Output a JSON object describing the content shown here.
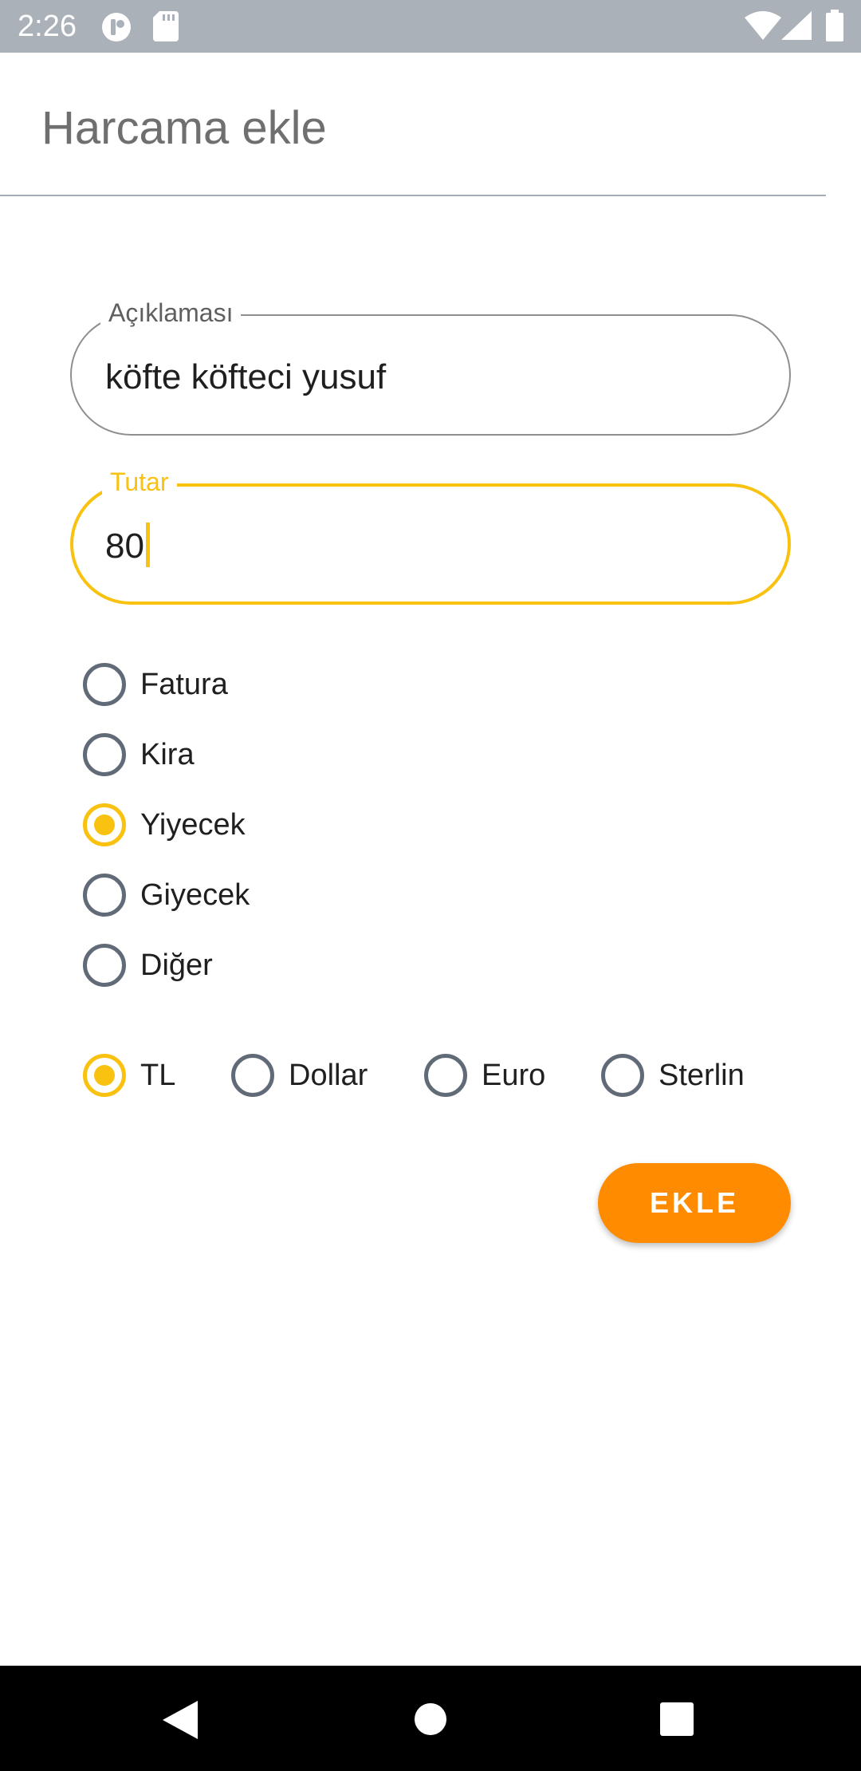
{
  "status_bar": {
    "time": "2:26",
    "icons": [
      "notification-circle-icon",
      "sd-card-icon",
      "wifi-icon",
      "signal-icon",
      "battery-icon"
    ]
  },
  "page": {
    "title": "Harcama ekle"
  },
  "form": {
    "description": {
      "label": "Açıklaması",
      "value": "köfte köfteci yusuf"
    },
    "amount": {
      "label": "Tutar",
      "value": "80"
    }
  },
  "categories": [
    {
      "label": "Fatura",
      "checked": false
    },
    {
      "label": "Kira",
      "checked": false
    },
    {
      "label": "Yiyecek",
      "checked": true
    },
    {
      "label": "Giyecek",
      "checked": false
    },
    {
      "label": "Diğer",
      "checked": false
    }
  ],
  "currencies": [
    {
      "label": "TL",
      "checked": true
    },
    {
      "label": "Dollar",
      "checked": false
    },
    {
      "label": "Euro",
      "checked": false
    },
    {
      "label": "Sterlin",
      "checked": false
    }
  ],
  "actions": {
    "add_label": "EKLE"
  },
  "colors": {
    "accent": "#f9c110",
    "button": "#ff8c00",
    "status_bar": "#aab1b9"
  },
  "nav_bar": {
    "icons": [
      "back-icon",
      "home-icon",
      "recents-icon"
    ]
  }
}
